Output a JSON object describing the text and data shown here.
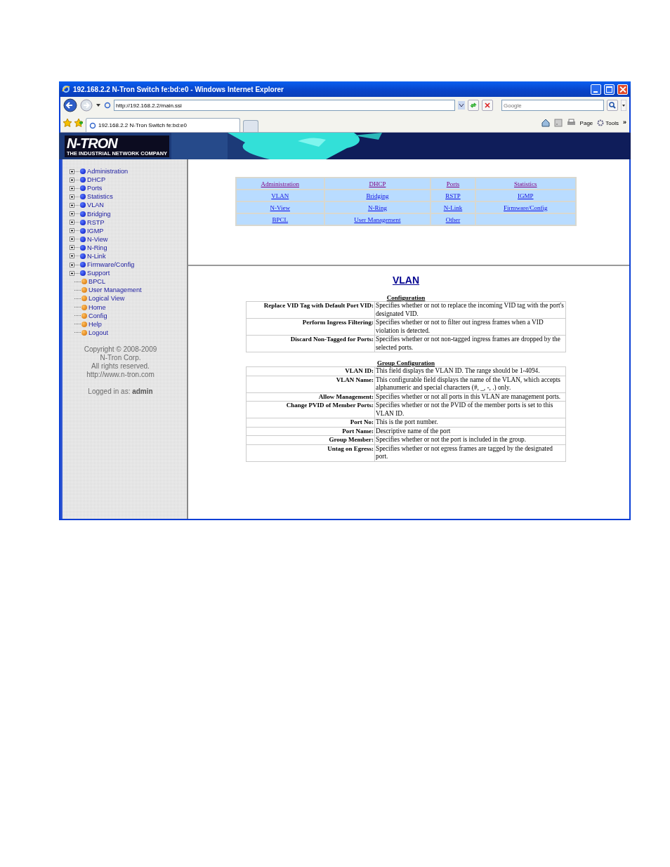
{
  "window": {
    "title": "192.168.2.2 N-Tron Switch fe:bd:e0 - Windows Internet Explorer"
  },
  "address_bar": {
    "url": "http://192.168.2.2/main.ssi"
  },
  "search": {
    "placeholder": "Google"
  },
  "tab": {
    "title": "192.168.2.2 N-Tron Switch fe:bd:e0"
  },
  "command_bar": {
    "page": "Page",
    "tools": "Tools",
    "more": "»"
  },
  "banner": {
    "logo": "N-TRON",
    "tagline": "THE INDUSTRIAL NETWORK COMPANY"
  },
  "sidebar": {
    "items": [
      {
        "label": "Administration",
        "kind": "folder"
      },
      {
        "label": "DHCP",
        "kind": "folder"
      },
      {
        "label": "Ports",
        "kind": "folder"
      },
      {
        "label": "Statistics",
        "kind": "folder"
      },
      {
        "label": "VLAN",
        "kind": "folder"
      },
      {
        "label": "Bridging",
        "kind": "folder"
      },
      {
        "label": "RSTP",
        "kind": "folder"
      },
      {
        "label": "IGMP",
        "kind": "folder"
      },
      {
        "label": "N-View",
        "kind": "folder"
      },
      {
        "label": "N-Ring",
        "kind": "folder"
      },
      {
        "label": "N-Link",
        "kind": "folder"
      },
      {
        "label": "Firmware/Config",
        "kind": "folder"
      },
      {
        "label": "Support",
        "kind": "folder"
      },
      {
        "label": "BPCL",
        "kind": "page"
      },
      {
        "label": "User Management",
        "kind": "page"
      },
      {
        "label": "Logical View",
        "kind": "page"
      },
      {
        "label": "Home",
        "kind": "page"
      },
      {
        "label": "Config",
        "kind": "page"
      },
      {
        "label": "Help",
        "kind": "page"
      },
      {
        "label": "Logout",
        "kind": "page"
      }
    ],
    "copyright": [
      "Copyright © 2008-2009",
      "N-Tron Corp.",
      "All rights reserved.",
      "http://www.n-tron.com"
    ],
    "login_label": "Logged in as:",
    "login_user": "admin"
  },
  "nav_links": [
    {
      "label": "Administration",
      "visited": true
    },
    {
      "label": "DHCP",
      "visited": true
    },
    {
      "label": "Ports",
      "visited": true
    },
    {
      "label": "Statistics",
      "visited": true
    },
    {
      "label": "VLAN",
      "visited": false
    },
    {
      "label": "Bridging",
      "visited": false
    },
    {
      "label": "RSTP",
      "visited": false
    },
    {
      "label": "IGMP",
      "visited": false
    },
    {
      "label": "N-View",
      "visited": false
    },
    {
      "label": "N-Ring",
      "visited": false
    },
    {
      "label": "N-Link",
      "visited": false
    },
    {
      "label": "Firmware/Config",
      "visited": false
    },
    {
      "label": "BPCL",
      "visited": false
    },
    {
      "label": "User Management",
      "visited": false
    },
    {
      "label": "Other",
      "visited": false
    }
  ],
  "help": {
    "title": "VLAN",
    "sections": [
      {
        "heading": "Configuration",
        "rows": [
          {
            "term": "Replace VID Tag with Default Port VID:",
            "text": "Specifies whether or not to replace the incoming VID tag with the port's designated VID."
          },
          {
            "term": "Perform Ingress Filtering:",
            "text": "Specifies whether or not to filter out ingress frames when a VID violation is detected."
          },
          {
            "term": "Discard Non-Tagged for Ports:",
            "text": "Specifies whether or not non-tagged ingress frames are dropped by the selected ports."
          }
        ]
      },
      {
        "heading": "Group Configuration",
        "rows": [
          {
            "term": "VLAN ID:",
            "text": "This field displays the VLAN ID. The range should be 1-4094."
          },
          {
            "term": "VLAN Name:",
            "text": "This configurable field displays the name of the VLAN, which accepts alphanumeric and special characters (#, _, -, .) only."
          },
          {
            "term": "Allow Management:",
            "text": "Specifies whether or not all ports in this VLAN are management ports."
          },
          {
            "term": "Change PVID of Member Ports:",
            "text": "Specifies whether or not the PVID of the member ports is set to this VLAN ID."
          },
          {
            "term": "Port No:",
            "text": "This is the port number."
          },
          {
            "term": "Port Name:",
            "text": "Descriptive name of the port"
          },
          {
            "term": "Group Member:",
            "text": "Specifies whether or not the port is included in the group."
          },
          {
            "term": "Untag on Egress:",
            "text": "Specifies whether or not egress frames are tagged by the designated port."
          }
        ]
      }
    ]
  }
}
